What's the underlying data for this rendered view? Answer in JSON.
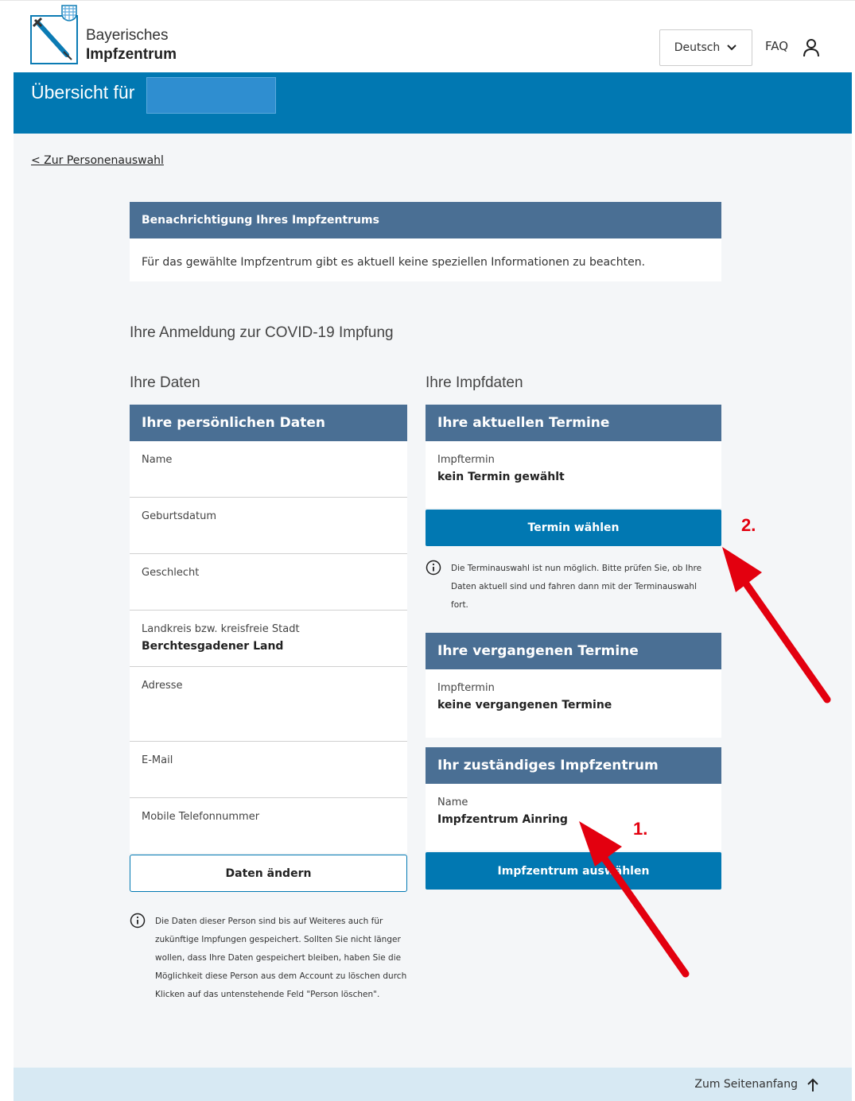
{
  "header": {
    "logo_line1": "Bayerisches",
    "logo_line2": "Impfzentrum",
    "language": "Deutsch",
    "faq": "FAQ"
  },
  "banner": {
    "title": "Übersicht für"
  },
  "nav": {
    "back_link": "< Zur Personenauswahl"
  },
  "notice": {
    "title": "Benachrichtigung Ihres Impfzentrums",
    "body": "Für das gewählte Impfzentrum gibt es aktuell keine speziellen Informationen zu beachten."
  },
  "registration": {
    "title": "Ihre Anmeldung zur COVID-19 Impfung"
  },
  "personal": {
    "column_title": "Ihre Daten",
    "panel_title": "Ihre persönlichen Daten",
    "rows": [
      {
        "label": "Name",
        "value": ""
      },
      {
        "label": "Geburtsdatum",
        "value": ""
      },
      {
        "label": "Geschlecht",
        "value": ""
      },
      {
        "label": "Landkreis bzw. kreisfreie Stadt",
        "value": "Berchtesgadener Land"
      },
      {
        "label": "Adresse",
        "value": ""
      },
      {
        "label": "E-Mail",
        "value": ""
      },
      {
        "label": "Mobile Telefonnummer",
        "value": ""
      }
    ],
    "edit_button": "Daten ändern",
    "info_lines": [
      "Die Daten dieser Person sind bis auf Weiteres auch für",
      "zukünftige Impfungen gespeichert. Sollten Sie nicht länger",
      "wollen, dass Ihre Daten gespeichert bleiben, haben Sie die",
      "Möglichkeit diese Person aus dem Account zu löschen durch",
      "Klicken auf das untenstehende Feld \"Person löschen\"."
    ]
  },
  "vaccination": {
    "column_title": "Ihre Impfdaten",
    "current": {
      "panel_title": "Ihre aktuellen Termine",
      "label": "Impftermin",
      "value": "kein Termin gewählt",
      "button": "Termin wählen",
      "info_lines": [
        "Die Terminauswahl ist nun möglich. Bitte prüfen Sie, ob Ihre",
        "Daten aktuell sind und fahren dann mit der Terminauswahl",
        "fort."
      ]
    },
    "past": {
      "panel_title": "Ihre vergangenen Termine",
      "label": "Impftermin",
      "value": "keine vergangenen Termine"
    },
    "center": {
      "panel_title": "Ihr zuständiges Impfzentrum",
      "label": "Name",
      "value": "Impfzentrum Ainring",
      "button": "Impfzentrum auswählen"
    }
  },
  "annotations": {
    "step1": "1.",
    "step2": "2.",
    "color": "#e3000f"
  },
  "footer": {
    "back_to_top": "Zum Seitenanfang"
  },
  "colors": {
    "primary": "#0178b2",
    "panel_header": "#4a6f94",
    "page_bg": "#f4f6f8",
    "footer_bg": "#d7e9f3"
  }
}
